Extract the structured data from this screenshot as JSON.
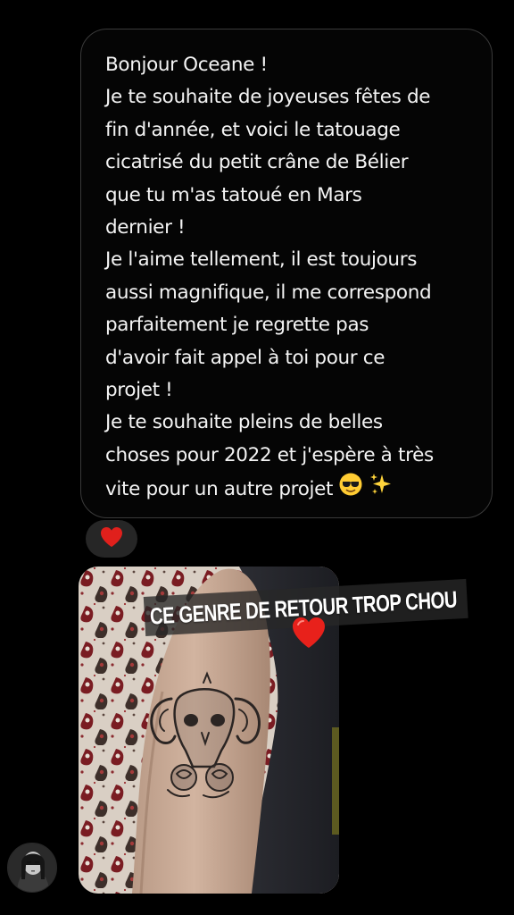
{
  "message": {
    "lines": [
      "Bonjour Oceane !",
      "Je te souhaite de joyeuses fêtes de",
      "fin d'année, et voici le tatouage",
      "cicatrisé du petit crâne de Bélier",
      "que tu m'as tatoué en Mars",
      "dernier !",
      "Je l'aime tellement, il est toujours",
      "aussi magnifique, il me correspond",
      "parfaitement je regrette pas",
      "d'avoir fait appel à toi pour ce",
      "projet !",
      "Je te souhaite pleins de belles",
      "choses pour 2022 et j'espère à très",
      "vite pour un autre projet"
    ],
    "emojis": [
      "sunglasses-emoji",
      "sparkles-emoji"
    ]
  },
  "reaction": {
    "icon": "heart-icon",
    "color": "#e0201c"
  },
  "story_sticker": {
    "text": "CE GENRE DE RETOUR TROP CHOU",
    "heart_icon": "heart-icon",
    "heart_color": "#e8211b"
  },
  "photo": {
    "subject": "ram-skull-tattoo-photo"
  },
  "avatar": {
    "icon": "avatar"
  },
  "colors": {
    "background": "#000000",
    "bubble_border": "#3a3a3a",
    "reaction_pill": "#262626",
    "text": "#f4f4f4"
  }
}
